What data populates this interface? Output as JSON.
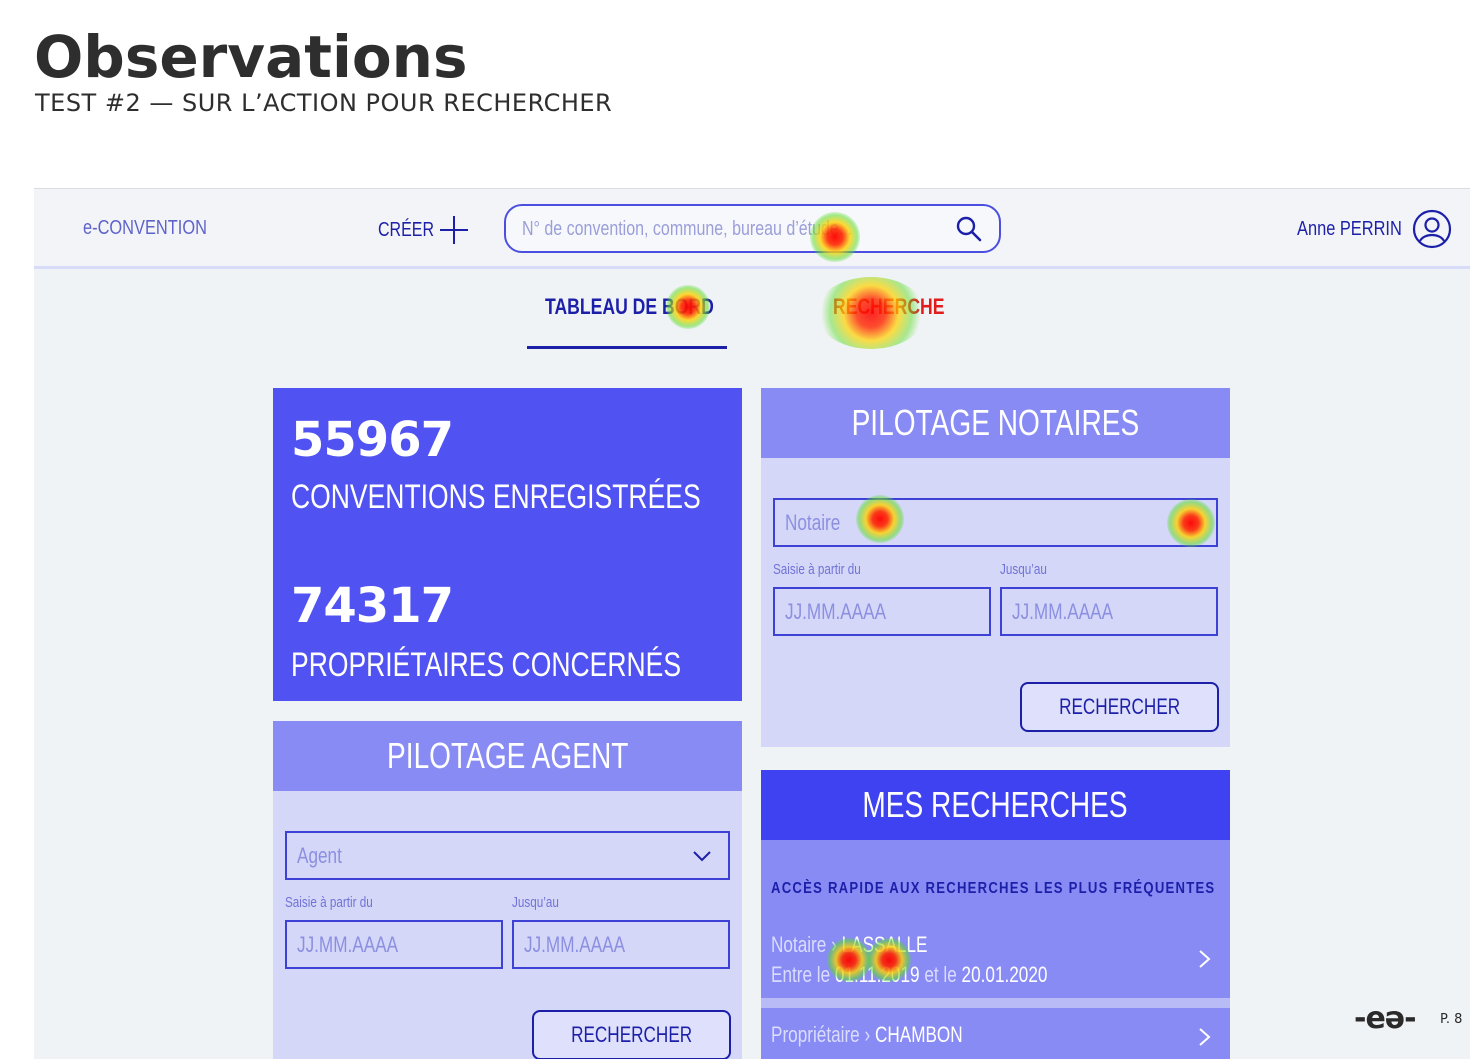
{
  "slide": {
    "title": "Observations",
    "subtitle": "TEST #2 — SUR L’ACTION POUR RECHERCHER",
    "page_number": "P. 8",
    "logo_text": "-eə-"
  },
  "topbar": {
    "brand": "e-CONVENTION",
    "create_label": "CRÉER",
    "search_placeholder": "N° de convention, commune, bureau d’étude...",
    "user_name": "Anne PERRIN"
  },
  "tabs": [
    {
      "label": "TABLEAU DE BORD",
      "active": true
    },
    {
      "label": "RECHERCHE",
      "active": false
    }
  ],
  "stats": {
    "conventions_count": "55967",
    "conventions_label": "CONVENTIONS ENREGISTRÉES",
    "owners_count": "74317",
    "owners_label": "PROPRIÉTAIRES CONCERNÉS"
  },
  "pilotage_notaires": {
    "title": "PILOTAGE NOTAIRES",
    "notaire_placeholder": "Notaire",
    "from_label": "Saisie à partir du",
    "to_label": "Jusqu’au",
    "from_placeholder": "JJ.MM.AAAA",
    "to_placeholder": "JJ.MM.AAAA",
    "search_button": "RECHERCHER"
  },
  "pilotage_agent": {
    "title": "PILOTAGE AGENT",
    "agent_placeholder": "Agent",
    "from_label": "Saisie à partir du",
    "to_label": "Jusqu’au",
    "from_placeholder": "JJ.MM.AAAA",
    "to_placeholder": "JJ.MM.AAAA",
    "search_button": "RECHERCHER"
  },
  "mes_recherches": {
    "title": "MES RECHERCHES",
    "quick_access": "ACCÈS RAPIDE AUX RECHERCHES LES PLUS FRÉQUENTES",
    "items": [
      {
        "type": "Notaire ›",
        "name": "LASSALLE",
        "range_prefix": "Entre le",
        "from": "01.11.2019",
        "range_mid": "et le",
        "to": "20.01.2020"
      },
      {
        "type": "Propriétaire ›",
        "name": "CHAMBON"
      }
    ]
  },
  "colors": {
    "primary": "#1c1fa8",
    "stats_bg": "#5053f2",
    "panel_head_light": "#888bf4",
    "panel_head_dark": "#3f42f0",
    "panel_bg": "#d5d7f9",
    "heatmap_hot": "#ff0000"
  }
}
